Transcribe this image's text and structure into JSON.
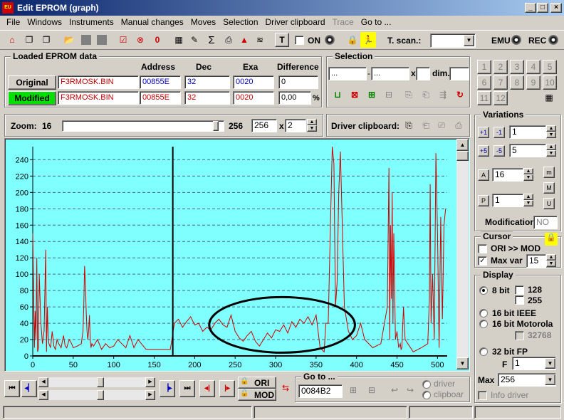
{
  "window": {
    "title": "Edit EPROM (graph)",
    "icon_text": "EU"
  },
  "menu": [
    "File",
    "Windows",
    "Instruments",
    "Manual changes",
    "Moves",
    "Selection",
    "Driver clipboard",
    "Trace",
    "Go to ..."
  ],
  "toolbar": {
    "on_label": "ON",
    "tscan_label": "T. scan.:",
    "tscan_value": "",
    "emu_label": "EMU",
    "rec_label": "REC"
  },
  "loaded": {
    "title": "Loaded EPROM data",
    "headers": [
      "Address",
      "Dec",
      "Exa",
      "Difference"
    ],
    "original": {
      "label": "Original",
      "file": "F3RMOSK.BIN",
      "address": "00855E",
      "dec": "32",
      "exa": "0020",
      "diff": "0"
    },
    "modified": {
      "label": "Modified",
      "file": "F3RMOSK.BIN",
      "address": "00855E",
      "dec": "32",
      "exa": "0020",
      "diff": "0,00",
      "diff_unit": "%"
    }
  },
  "selection": {
    "title": "Selection",
    "from": "...",
    "sep": "-",
    "to": "...",
    "x_label": "x",
    "x_value": "",
    "dim_label": "dim.",
    "dim_value": ""
  },
  "numpad": [
    "1",
    "2",
    "3",
    "4",
    "5",
    "6",
    "7",
    "8",
    "9",
    "10",
    "11",
    "12"
  ],
  "zoom": {
    "label": "Zoom:",
    "value": "16",
    "max_label": "256",
    "field": "256",
    "x_label": "x",
    "mult": "2",
    "slider_pct": 97
  },
  "driver_clipboard": {
    "label": "Driver clipboard:"
  },
  "variations": {
    "title": "Variations",
    "v1": "1",
    "v2": "5",
    "v3": "16",
    "v4": "1",
    "modif_label": "Modification",
    "modif_value": "NO"
  },
  "cursor": {
    "title": "Cursor",
    "ori_mod": "ORI >> MOD",
    "maxvar_label": "Max var",
    "maxvar_value": "15",
    "maxvar_checked": "✓"
  },
  "display": {
    "title": "Display",
    "bit8": "8 bit",
    "o128": "128",
    "o255": "255",
    "ieee": "16 bit IEEE",
    "motorola": "16 bit Motorola",
    "o32768": "32768",
    "fp32": "32 bit FP",
    "f_label": "F",
    "f_value": "1",
    "max_label": "Max",
    "max_value": "256",
    "info_driver": "Info driver"
  },
  "bottom": {
    "ori": "ORI",
    "mod": "MOD",
    "goto_title": "Go to ...",
    "goto_value": "0084B2",
    "driver": "driver",
    "clipboard": "clipboar"
  },
  "colors": {
    "plot_bg": "#80ffff",
    "series": "#d00000",
    "annotation": "#000000",
    "modified_btn": "#00e000"
  },
  "chart_data": {
    "type": "line",
    "xlim": [
      0,
      512
    ],
    "ylim": [
      0,
      256
    ],
    "x_ticks": [
      "0",
      "50",
      "100",
      "150",
      "200",
      "250",
      "300",
      "350",
      "400",
      "450",
      "500"
    ],
    "y_ticks": [
      "0",
      "20",
      "40",
      "60",
      "80",
      "100",
      "120",
      "140",
      "160",
      "180",
      "200",
      "220",
      "240"
    ],
    "grid": "horizontal dashed",
    "cursor_x": 173,
    "series": [
      {
        "x": [
          0,
          2,
          3,
          4,
          5,
          6,
          7,
          8,
          10,
          12,
          14,
          16,
          17,
          18,
          19,
          20,
          22,
          24,
          26,
          28,
          30,
          32,
          35,
          38,
          40,
          42,
          45,
          48,
          50,
          55,
          60,
          62,
          63,
          64,
          65,
          66,
          67,
          68,
          69,
          70,
          71,
          72,
          73,
          75,
          80,
          85,
          90,
          95,
          100,
          105,
          110,
          115,
          120,
          125,
          130,
          140,
          150,
          160,
          170,
          175,
          180,
          185,
          190,
          195,
          200,
          205,
          210,
          215,
          220,
          225,
          230,
          235,
          240,
          245,
          250,
          255,
          260,
          265,
          270,
          275,
          280,
          285,
          290,
          295,
          300,
          305,
          310,
          315,
          320,
          325,
          330,
          335,
          340,
          345,
          350,
          355,
          360,
          362,
          365,
          368,
          370,
          372,
          374,
          376,
          378,
          380,
          385,
          390,
          395,
          400,
          405,
          410,
          420,
          430,
          438,
          440,
          441,
          442,
          443,
          444,
          445,
          446,
          448,
          450,
          452,
          454,
          455,
          456,
          458,
          460,
          470,
          480,
          488,
          490,
          491,
          492,
          494,
          496,
          498,
          500,
          502,
          504,
          506,
          508,
          510
        ],
        "y": [
          150,
          10,
          55,
          20,
          120,
          5,
          10,
          100,
          40,
          15,
          30,
          130,
          5,
          60,
          25,
          15,
          10,
          30,
          12,
          8,
          20,
          15,
          10,
          25,
          12,
          10,
          20,
          15,
          10,
          12,
          15,
          30,
          60,
          110,
          90,
          55,
          30,
          20,
          30,
          50,
          20,
          10,
          15,
          12,
          20,
          8,
          15,
          10,
          12,
          20,
          15,
          10,
          25,
          10,
          20,
          8,
          8,
          8,
          8,
          40,
          45,
          35,
          42,
          48,
          38,
          40,
          30,
          35,
          32,
          40,
          45,
          38,
          35,
          50,
          30,
          22,
          18,
          25,
          30,
          18,
          12,
          20,
          28,
          22,
          32,
          30,
          38,
          28,
          42,
          35,
          45,
          40,
          48,
          38,
          50,
          10,
          5,
          40,
          40,
          170,
          258,
          235,
          60,
          90,
          200,
          250,
          60,
          30,
          20,
          25,
          40,
          20,
          10,
          15,
          60,
          230,
          20,
          160,
          70,
          200,
          40,
          150,
          20,
          30,
          10,
          15,
          8,
          10,
          60,
          20,
          5,
          10,
          15,
          70,
          210,
          40,
          100,
          20,
          248,
          150,
          10,
          170,
          45,
          160,
          180
        ]
      }
    ],
    "annotation": {
      "type": "ellipse",
      "cx": 308,
      "cy": 38,
      "rx": 90,
      "ry": 34,
      "units": "data"
    }
  }
}
